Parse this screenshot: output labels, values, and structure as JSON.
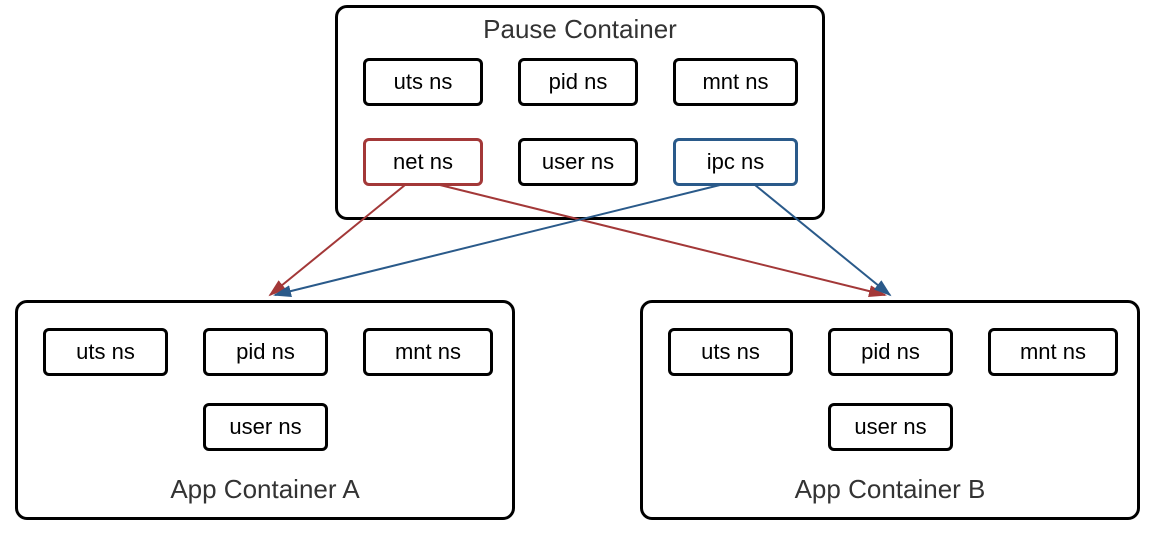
{
  "pause_container": {
    "title": "Pause Container",
    "namespaces": {
      "uts": "uts ns",
      "pid": "pid ns",
      "mnt": "mnt ns",
      "net": "net ns",
      "user": "user ns",
      "ipc": "ipc ns"
    }
  },
  "app_container_a": {
    "title": "App Container A",
    "namespaces": {
      "uts": "uts ns",
      "pid": "pid ns",
      "mnt": "mnt ns",
      "user": "user ns"
    }
  },
  "app_container_b": {
    "title": "App Container B",
    "namespaces": {
      "uts": "uts ns",
      "pid": "pid ns",
      "mnt": "mnt ns",
      "user": "user ns"
    }
  },
  "colors": {
    "red": "#a33838",
    "blue": "#2a5a8a"
  }
}
